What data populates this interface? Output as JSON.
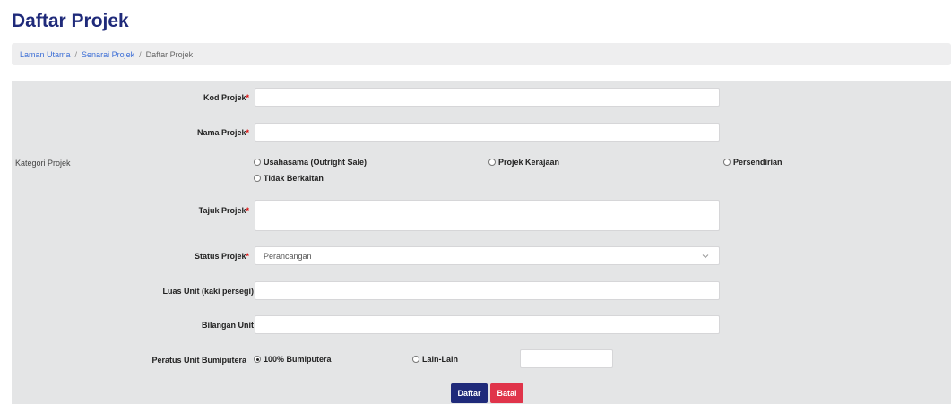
{
  "page": {
    "title": "Daftar Projek"
  },
  "breadcrumb": {
    "items": [
      "Laman Utama",
      "Senarai Projek",
      "Daftar Projek"
    ],
    "separator": "/"
  },
  "form": {
    "kod_projek": {
      "label": "Kod Projek",
      "required_mark": "*",
      "value": ""
    },
    "nama_projek": {
      "label": "Nama Projek",
      "required_mark": "*",
      "value": ""
    },
    "kategori_projek": {
      "label": "Kategori Projek",
      "options": [
        {
          "label": "Usahasama (Outright Sale)",
          "checked": false
        },
        {
          "label": "Projek Kerajaan",
          "checked": false
        },
        {
          "label": "Persendirian",
          "checked": false
        },
        {
          "label": "Tidak Berkaitan",
          "checked": false
        }
      ]
    },
    "tajuk_projek": {
      "label": "Tajuk Projek",
      "required_mark": "*",
      "value": ""
    },
    "status_projek": {
      "label": "Status Projek",
      "required_mark": "*",
      "selected": "Perancangan"
    },
    "luas_unit": {
      "label": "Luas Unit (kaki persegi)",
      "value": ""
    },
    "bilangan_unit": {
      "label": "Bilangan Unit",
      "value": ""
    },
    "peratus_bumiputera": {
      "label": "Peratus Unit Bumiputera",
      "options": [
        {
          "label": "100% Bumiputera",
          "checked": true
        },
        {
          "label": "Lain-Lain",
          "checked": false
        }
      ],
      "other_value": ""
    }
  },
  "actions": {
    "submit_label": "Daftar",
    "cancel_label": "Batal"
  },
  "colors": {
    "primary": "#1f2a7a",
    "danger": "#e0344a",
    "link": "#3d6fd6",
    "panel": "#e4e5e6"
  }
}
